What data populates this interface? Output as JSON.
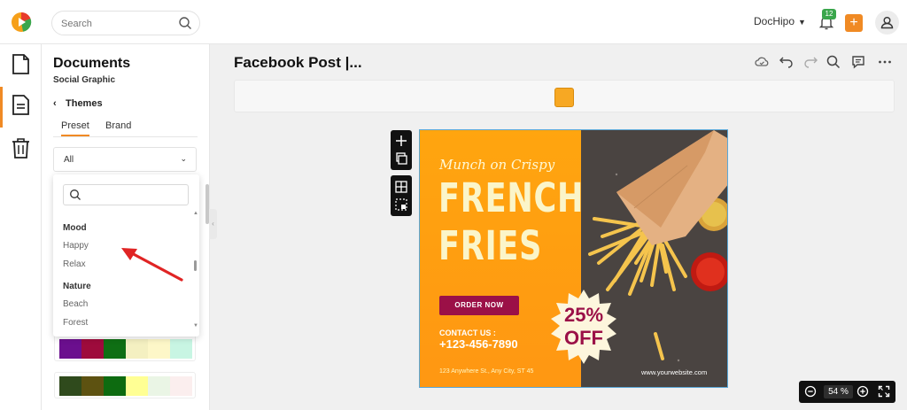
{
  "header": {
    "search": {
      "placeholder": "Search"
    },
    "account_name": "DocHipo",
    "notifications_count": "12",
    "add_label": "+"
  },
  "sidebar_rail": {
    "items": [
      {
        "name": "documents",
        "icon": "document-icon"
      },
      {
        "name": "document-list",
        "icon": "document-lines-icon",
        "active": true
      },
      {
        "name": "trash",
        "icon": "trash-icon"
      }
    ]
  },
  "panel": {
    "title": "Documents",
    "subtitle": "Social Graphic",
    "back_label": "Themes",
    "tabs": [
      {
        "label": "Preset",
        "active": true
      },
      {
        "label": "Brand",
        "active": false
      }
    ],
    "filter": {
      "selected": "All",
      "search_placeholder": ""
    },
    "dropdown": {
      "groups": [
        {
          "label": "Mood",
          "items": [
            "Happy",
            "Relax"
          ]
        },
        {
          "label": "Nature",
          "items": [
            "Beach",
            "Forest"
          ]
        }
      ]
    },
    "palettes": [
      [
        "#6b0f8e",
        "#9e0b3c",
        "#0f6f14",
        "#f4f0c1",
        "#fdf7c8",
        "#c8f5e3"
      ],
      [
        "#2f4a1c",
        "#5d5211",
        "#0d6b10",
        "#ffff94",
        "#eaf5e5",
        "#fbeeee"
      ]
    ]
  },
  "editor": {
    "doc_title": "Facebook Post |...",
    "toolbar_icons": [
      "cloud-icon",
      "undo-icon",
      "redo-icon",
      "search-icon",
      "comment-icon",
      "more-icon"
    ],
    "theme_color": "#f7a823",
    "zoom": {
      "value": "54",
      "unit": "%"
    }
  },
  "design": {
    "script_text": "Munch on Crispy",
    "headline_1": "FRENCH",
    "headline_2": "FRIES",
    "cta": "ORDER NOW",
    "contact_label": "CONTACT US :",
    "phone": "+123-456-7890",
    "address": "123 Anywhere St., Any City, ST 45",
    "website": "www.yourwebsite.com",
    "discount_value": "25%",
    "discount_label": "OFF",
    "colors": {
      "orange": "#ff9f12",
      "cream": "#fbf5c9",
      "burgundy": "#9b1047",
      "dark": "#4a4441"
    }
  }
}
